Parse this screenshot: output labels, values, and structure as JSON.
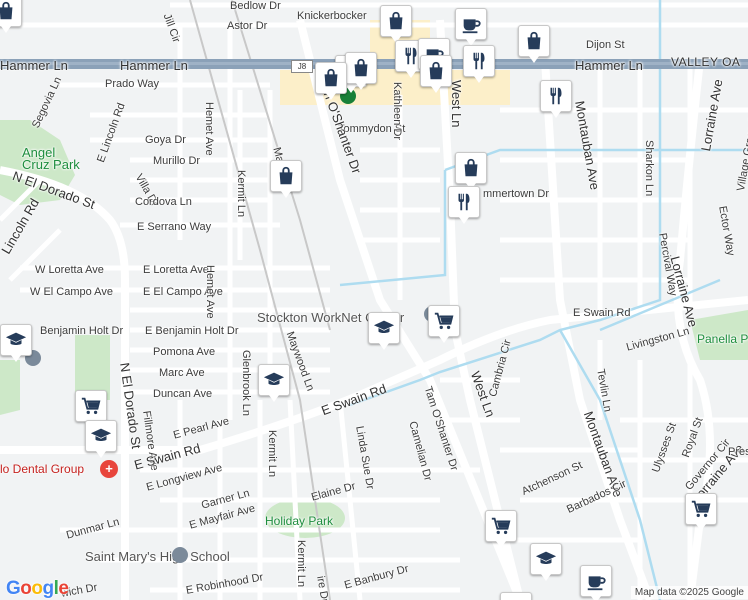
{
  "map": {
    "attribution": "Map data ©2025 Google",
    "logo": "Google",
    "highway_shield": "J8",
    "places": {
      "stockton_worknet": "Stockton WorkNet Center",
      "angel_cruz_park": "Angel Cruz Park",
      "panella_park": "Panella P",
      "holiday_park": "Holiday Park",
      "saint_marys": "Saint Mary's High School",
      "dental_group": "lo Dental Group"
    },
    "streets": {
      "bedlow": "Bedlow Dr",
      "astor": "Astor Dr",
      "knickerbocker": "Knickerbocker",
      "jill_cir": "Jill Cir",
      "dijon": "Dijon St",
      "hammer_left": "Hammer Ln",
      "hammer_mid": "Hammer Ln",
      "hammer_right": "Hammer Ln",
      "valley_oak": "VALLEY OA",
      "prado": "Prado Way",
      "segovia": "Segovia Ln",
      "tommydon": "Tommydon St",
      "kathleen": "Kathleen Dr",
      "tam_top": "n O'Shanter Dr",
      "west_top": "West Ln",
      "goya": "Goya Dr",
      "murillo": "Murillo Dr",
      "hemet_top": "Hemet Ave",
      "e_lincoln": "E Lincoln Rd",
      "n_el_dorado_top": "N El Dorado St",
      "villa": "Villa Dr",
      "cordova": "Cordova Ln",
      "kermit_top": "Kermit Ln",
      "lincoln_left": "Lincoln Rd",
      "e_serrano": "E Serrano Way",
      "montauban_top": "Montauban Ave",
      "sharkon": "Sharkon Ln",
      "lorraine_top": "Lorraine Ave",
      "village_green": "Village Green Dr",
      "ector": "Ector Way",
      "percival": "Percival Way",
      "lorraine_mid": "Lorraine Ave",
      "summertown": "mmertown Dr",
      "w_loretta": "W Loretta Ave",
      "e_loretta": "E Loretta Ave",
      "w_el_campo": "W El Campo Ave",
      "e_el_campo": "E El Campo Ave",
      "hemet_mid": "Hemet Ave",
      "ma_partial": "Ma",
      "e_swain_right": "E Swain Rd",
      "benjamin_w": "Benjamin Holt Dr",
      "benjamin_e": "E Benjamin Holt Dr",
      "maywood": "Maywood Ln",
      "livingston": "Livingston Ln",
      "pomona": "Pomona Ave",
      "marc": "Marc Ave",
      "duncan": "Duncan Ave",
      "glenbrook": "Glenbrook Ln",
      "west_mid": "West Ln",
      "cambria": "Cambria Cir",
      "tevlin": "Tevlin Ln",
      "tam_mid": "Tam O'Shanter Dr",
      "n_el_dorado": "N El Dorado St",
      "fillmore": "Fillmore Ave",
      "e_pearl": "E Pearl Ave",
      "e_swain_mid": "E Swain Rd",
      "e_swain_low": "E Swain Rd",
      "kermit_mid": "Kermit Ln",
      "linda_sue": "Linda Sue Dr",
      "camelian": "Camelian Dr",
      "montauban_low": "Montauban Ave",
      "ulysses": "Ulysses St",
      "royal": "Royal St",
      "governor": "Governor Cir",
      "lorraine_low": "Lorraine Ave",
      "pres": "Pres",
      "e_longview": "E Longview Ave",
      "atchenson": "Atchenson St",
      "barbados": "Barbados Cir",
      "garner": "Garner Ln",
      "elaine": "Elaine Dr",
      "e_mayfair": "E Mayfair Ave",
      "dunmar": "Dunmar Ln",
      "kermit_low": "Kermit Ln",
      "e_banbury": "E Banbury Dr",
      "ire": "ire Dr",
      "robinhood": "E Robinhood Dr",
      "wich": "wich Dr"
    }
  },
  "markers": [
    {
      "type": "shopping",
      "icon": "shopping-bag-icon"
    },
    {
      "type": "shopping",
      "icon": "shopping-bag-icon"
    },
    {
      "type": "cafe",
      "icon": "coffee-cup-icon"
    },
    {
      "type": "shopping",
      "icon": "shopping-bag-icon"
    },
    {
      "type": "shopping",
      "icon": "shopping-bag-icon"
    },
    {
      "type": "shopping",
      "icon": "shopping-bag-icon"
    },
    {
      "type": "restaurant",
      "icon": "fork-knife-icon"
    },
    {
      "type": "cafe",
      "icon": "coffee-cup-icon"
    },
    {
      "type": "restaurant",
      "icon": "fork-knife-icon"
    },
    {
      "type": "shopping",
      "icon": "shopping-bag-icon"
    },
    {
      "type": "shopping",
      "icon": "shopping-bag-icon"
    },
    {
      "type": "restaurant",
      "icon": "fork-knife-icon"
    },
    {
      "type": "shopping",
      "icon": "shopping-bag-icon"
    },
    {
      "type": "shopping",
      "icon": "shopping-bag-icon"
    },
    {
      "type": "restaurant",
      "icon": "fork-knife-icon"
    },
    {
      "type": "school",
      "icon": "graduation-cap-icon"
    },
    {
      "type": "school",
      "icon": "graduation-cap-icon"
    },
    {
      "type": "grocery",
      "icon": "shopping-cart-icon"
    },
    {
      "type": "school",
      "icon": "graduation-cap-icon"
    },
    {
      "type": "grocery",
      "icon": "shopping-cart-icon"
    },
    {
      "type": "school",
      "icon": "graduation-cap-icon"
    },
    {
      "type": "grocery",
      "icon": "shopping-cart-icon"
    },
    {
      "type": "grocery",
      "icon": "shopping-cart-icon"
    },
    {
      "type": "school",
      "icon": "graduation-cap-icon"
    },
    {
      "type": "cafe",
      "icon": "coffee-cup-icon"
    },
    {
      "type": "school",
      "icon": "graduation-cap-icon"
    }
  ]
}
